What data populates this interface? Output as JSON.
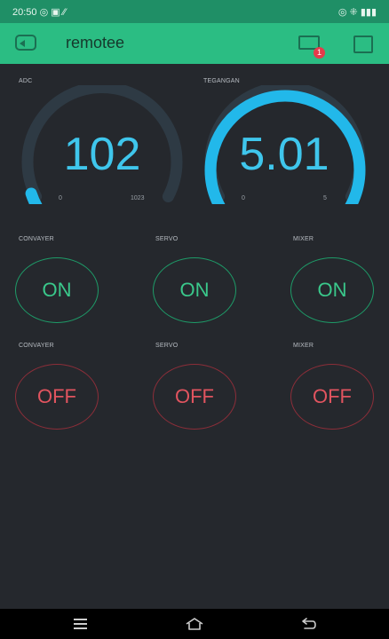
{
  "status_bar": {
    "time": "20:50",
    "left_icons": "◎ ▣ ⁄⁄",
    "right_icons": "◎ ⁜ ▮▮▮"
  },
  "app_bar": {
    "title": "remotee",
    "notification_count": "1"
  },
  "gauges": [
    {
      "label": "ADC",
      "value": "102",
      "min": "0",
      "max": "1023",
      "fill": 0.1
    },
    {
      "label": "TEGANGAN",
      "value": "5.01",
      "min": "0",
      "max": "5",
      "fill": 1.0
    }
  ],
  "buttons_on": [
    {
      "label": "CONVAYER",
      "state": "ON"
    },
    {
      "label": "SERVO",
      "state": "ON"
    },
    {
      "label": "MIXER",
      "state": "ON"
    }
  ],
  "buttons_off": [
    {
      "label": "CONVAYER",
      "state": "OFF"
    },
    {
      "label": "SERVO",
      "state": "OFF"
    },
    {
      "label": "MIXER",
      "state": "OFF"
    }
  ],
  "colors": {
    "accent": "#2bbd83",
    "gauge": "#22b8ea",
    "on": "#3ac88b",
    "off": "#e1545f",
    "background": "#25282d"
  },
  "icons": {
    "back": "back-icon",
    "device": "device-icon",
    "square": "square-icon",
    "menu": "menu-icon",
    "home": "home-icon",
    "nav_back": "nav-back-icon"
  }
}
